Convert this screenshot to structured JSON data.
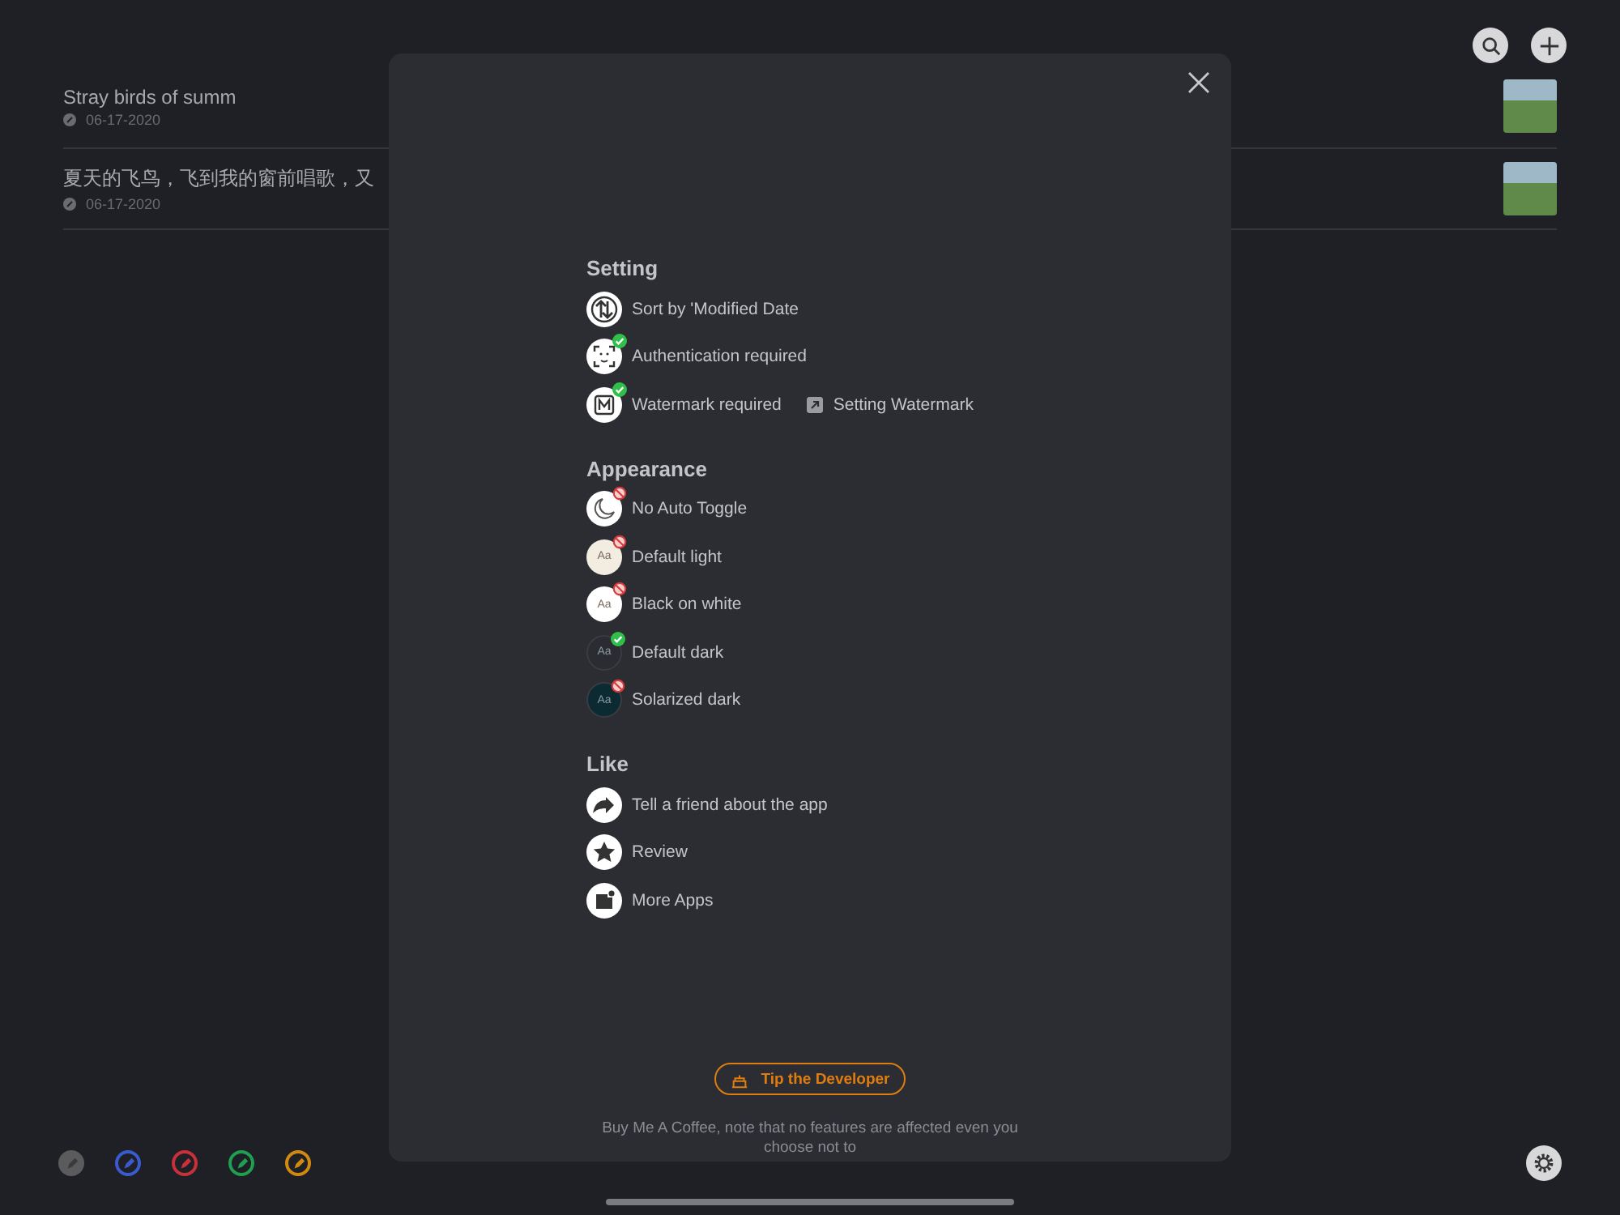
{
  "notes": [
    {
      "title": "Stray birds of summ",
      "date": "06-17-2020"
    },
    {
      "title": "夏天的飞鸟，飞到我的窗前唱歌，又",
      "date": "06-17-2020"
    }
  ],
  "modal": {
    "sections": [
      {
        "title": "Setting",
        "items": [
          {
            "kind": "sort",
            "label": "Sort by 'Modified Date"
          },
          {
            "kind": "face",
            "label": "Authentication required",
            "checked": true
          },
          {
            "kind": "watermark",
            "label": "Watermark required",
            "checked": true,
            "link": "Setting Watermark"
          }
        ]
      },
      {
        "title": "Appearance",
        "items": [
          {
            "kind": "moon",
            "label": "No Auto Toggle",
            "checked": false
          },
          {
            "kind": "theme",
            "label": "Default light",
            "checked": false,
            "color": "#f3ece0",
            "sample": "Aa"
          },
          {
            "kind": "theme",
            "label": "Black on white",
            "checked": false,
            "color": "#ffffff",
            "sample": "Aa"
          },
          {
            "kind": "theme",
            "label": "Default dark",
            "checked": true,
            "color": "#2a2c32",
            "sample": "Aa"
          },
          {
            "kind": "theme",
            "label": "Solarized dark",
            "checked": false,
            "color": "#0b2a32",
            "sample": "Aa"
          }
        ]
      },
      {
        "title": "Like",
        "items": [
          {
            "kind": "share",
            "label": "Tell a friend about the app"
          },
          {
            "kind": "star",
            "label": "Review"
          },
          {
            "kind": "apps",
            "label": "More Apps"
          }
        ]
      }
    ],
    "tip_button": "Tip the Developer",
    "tip_note": "Buy Me A Coffee, note that no features are affected even you choose not to"
  },
  "pens": [
    {
      "color": "#5b5b5e",
      "selected": true
    },
    {
      "color": "#3a5bd0",
      "selected": false
    },
    {
      "color": "#c8303a",
      "selected": false
    },
    {
      "color": "#1f9f50",
      "selected": false
    },
    {
      "color": "#d08a10",
      "selected": false
    }
  ]
}
